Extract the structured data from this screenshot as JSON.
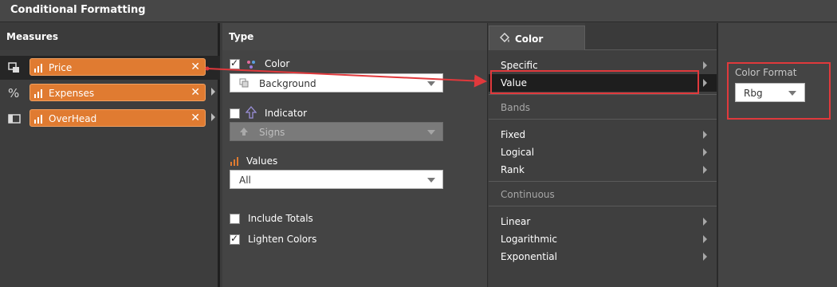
{
  "window": {
    "title": "Conditional Formatting"
  },
  "measures": {
    "header": "Measures",
    "items": [
      {
        "icon": "copy-icon",
        "label": "Price",
        "selected": true
      },
      {
        "icon": "percent-icon",
        "label": "Expenses",
        "selected": false
      },
      {
        "icon": "panel-icon",
        "label": "OverHead",
        "selected": false
      }
    ],
    "remove_glyph": "✕"
  },
  "type_panel": {
    "header": "Type",
    "color": {
      "label": "Color",
      "checked": true,
      "dropdown_value": "Background"
    },
    "indicator": {
      "label": "Indicator",
      "checked": false,
      "dropdown_value": "Signs"
    },
    "values": {
      "label": "Values",
      "dropdown_value": "All"
    },
    "include_totals": {
      "label": "Include Totals",
      "checked": false
    },
    "lighten_colors": {
      "label": "Lighten Colors",
      "checked": true
    }
  },
  "color_panel": {
    "tab_label": "Color",
    "items": [
      {
        "label": "Specific",
        "has_submenu": true,
        "selected": false
      },
      {
        "label": "Value",
        "has_submenu": true,
        "selected": true
      }
    ],
    "bands_label": "Bands",
    "bands_items": [
      {
        "label": "Fixed",
        "has_submenu": true
      },
      {
        "label": "Logical",
        "has_submenu": true
      },
      {
        "label": "Rank",
        "has_submenu": true
      }
    ],
    "continuous_label": "Continuous",
    "continuous_items": [
      {
        "label": "Linear",
        "has_submenu": true
      },
      {
        "label": "Logarithmic",
        "has_submenu": true
      },
      {
        "label": "Exponential",
        "has_submenu": true
      }
    ]
  },
  "settings_panel": {
    "color_format_label": "Color Format",
    "color_format_value": "Rbg"
  },
  "colors": {
    "accent_orange": "#e07b31",
    "highlight_red": "#e0393c"
  }
}
